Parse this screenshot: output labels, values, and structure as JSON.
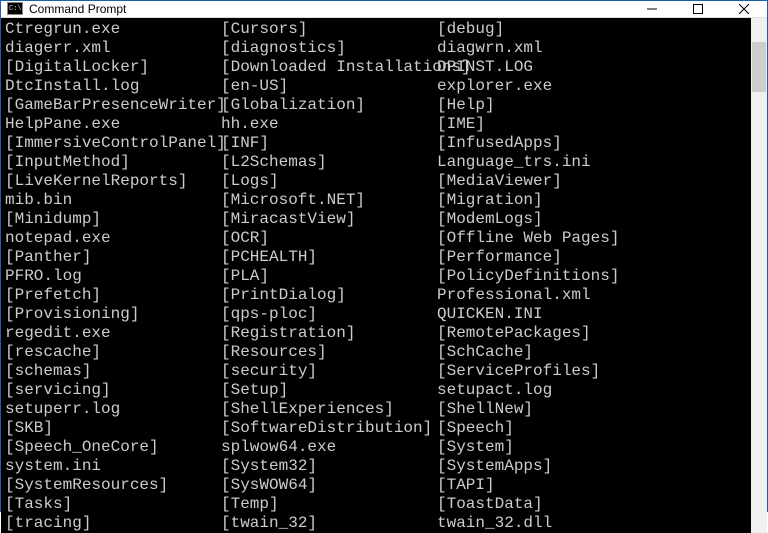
{
  "window": {
    "title": "Command Prompt"
  },
  "listing": {
    "columnWidths": {
      "col1": 27,
      "col2": 27
    },
    "rows": [
      {
        "c1": "Ctregrun.exe",
        "c2": "[Cursors]",
        "c3": "[debug]"
      },
      {
        "c1": "diagerr.xml",
        "c2": "[diagnostics]",
        "c3": "diagwrn.xml"
      },
      {
        "c1": "[DigitalLocker]",
        "c2": "[Downloaded Installations]",
        "c3": "DPINST.LOG"
      },
      {
        "c1": "DtcInstall.log",
        "c2": "[en-US]",
        "c3": "explorer.exe"
      },
      {
        "c1": "[GameBarPresenceWriter]",
        "c2": "[Globalization]",
        "c3": "[Help]"
      },
      {
        "c1": "HelpPane.exe",
        "c2": "hh.exe",
        "c3": "[IME]"
      },
      {
        "c1": "[ImmersiveControlPanel]",
        "c2": "[INF]",
        "c3": "[InfusedApps]"
      },
      {
        "c1": "[InputMethod]",
        "c2": "[L2Schemas]",
        "c3": "Language_trs.ini"
      },
      {
        "c1": "[LiveKernelReports]",
        "c2": "[Logs]",
        "c3": "[MediaViewer]"
      },
      {
        "c1": "mib.bin",
        "c2": "[Microsoft.NET]",
        "c3": "[Migration]"
      },
      {
        "c1": "[Minidump]",
        "c2": "[MiracastView]",
        "c3": "[ModemLogs]"
      },
      {
        "c1": "notepad.exe",
        "c2": "[OCR]",
        "c3": "[Offline Web Pages]"
      },
      {
        "c1": "[Panther]",
        "c2": "[PCHEALTH]",
        "c3": "[Performance]"
      },
      {
        "c1": "PFRO.log",
        "c2": "[PLA]",
        "c3": "[PolicyDefinitions]"
      },
      {
        "c1": "[Prefetch]",
        "c2": "[PrintDialog]",
        "c3": "Professional.xml"
      },
      {
        "c1": "[Provisioning]",
        "c2": "[qps-ploc]",
        "c3": "QUICKEN.INI"
      },
      {
        "c1": "regedit.exe",
        "c2": "[Registration]",
        "c3": "[RemotePackages]"
      },
      {
        "c1": "[rescache]",
        "c2": "[Resources]",
        "c3": "[SchCache]"
      },
      {
        "c1": "[schemas]",
        "c2": "[security]",
        "c3": "[ServiceProfiles]"
      },
      {
        "c1": "[servicing]",
        "c2": "[Setup]",
        "c3": "setupact.log"
      },
      {
        "c1": "setuperr.log",
        "c2": "[ShellExperiences]",
        "c3": "[ShellNew]"
      },
      {
        "c1": "[SKB]",
        "c2": "[SoftwareDistribution]",
        "c3": "[Speech]"
      },
      {
        "c1": "[Speech_OneCore]",
        "c2": "splwow64.exe",
        "c3": "[System]"
      },
      {
        "c1": "system.ini",
        "c2": "[System32]",
        "c3": "[SystemApps]"
      },
      {
        "c1": "[SystemResources]",
        "c2": "[SysWOW64]",
        "c3": "[TAPI]"
      },
      {
        "c1": "[Tasks]",
        "c2": "[Temp]",
        "c3": "[ToastData]"
      },
      {
        "c1": "[tracing]",
        "c2": "[twain_32]",
        "c3": "twain_32.dll"
      }
    ]
  }
}
